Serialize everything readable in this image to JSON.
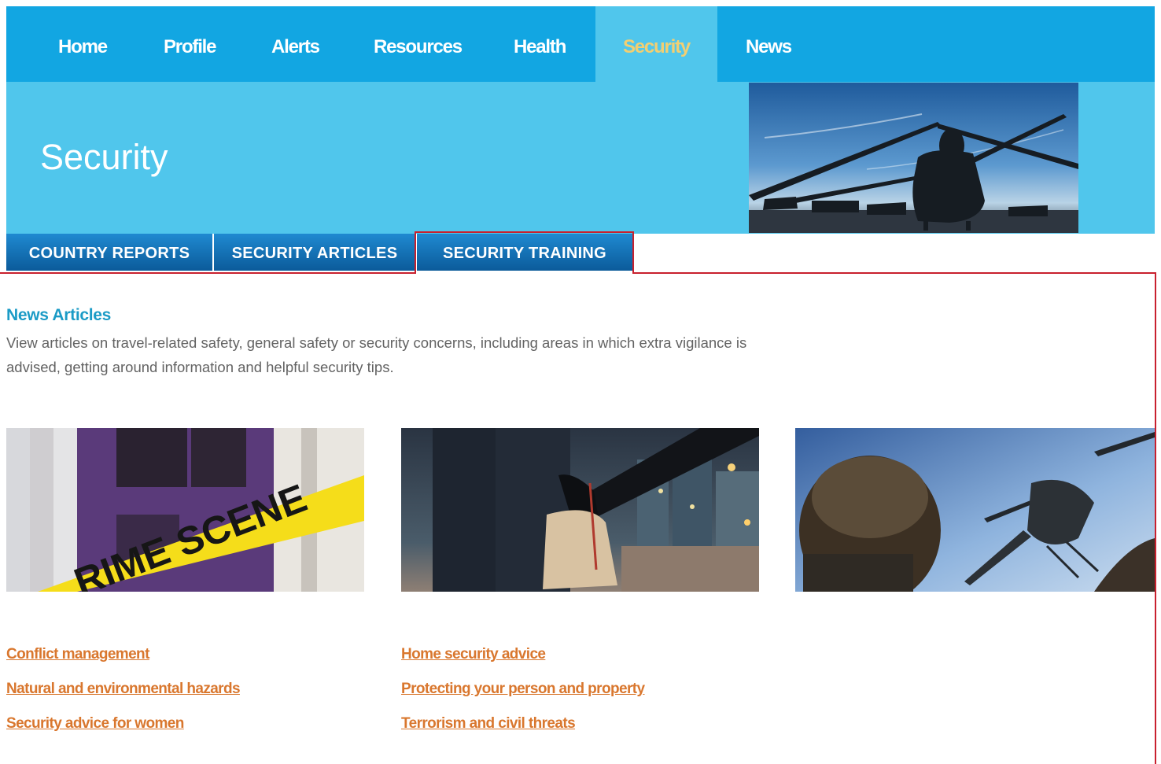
{
  "nav": {
    "items": [
      {
        "label": "Home"
      },
      {
        "label": "Profile"
      },
      {
        "label": "Alerts"
      },
      {
        "label": "Resources"
      },
      {
        "label": "Health"
      },
      {
        "label": "Security",
        "active": true
      },
      {
        "label": "News"
      }
    ]
  },
  "hero": {
    "title": "Security",
    "image_icon": "helicopter-image"
  },
  "subtabs": [
    {
      "label": "COUNTRY REPORTS"
    },
    {
      "label": "SECURITY ARTICLES"
    },
    {
      "label": "SECURITY TRAINING",
      "selected": true
    }
  ],
  "section": {
    "heading": "News Articles",
    "description": "View articles on travel-related safety, general safety or security concerns, including areas in which extra vigilance is advised, getting around information and helpful security tips."
  },
  "cards": [
    {
      "image": "crime-scene-tape-image",
      "caption_visible": "RIME SCENE"
    },
    {
      "image": "handbag-snatch-image"
    },
    {
      "image": "soldier-helicopter-image"
    }
  ],
  "links": {
    "column1": [
      "Conflict management",
      "Natural and environmental hazards",
      "Security advice for women"
    ],
    "column2": [
      "Home security advice",
      "Protecting your person and property",
      "Terrorism and civil threats"
    ]
  },
  "colors": {
    "nav_bg": "#12a6e2",
    "hero_bg": "#50c6ec",
    "active_nav_text": "#f2cf72",
    "tab_blue": "#0b5b9a",
    "heading_blue": "#1b9bc6",
    "link_orange": "#d9772e",
    "highlight_red": "#c8202e"
  }
}
